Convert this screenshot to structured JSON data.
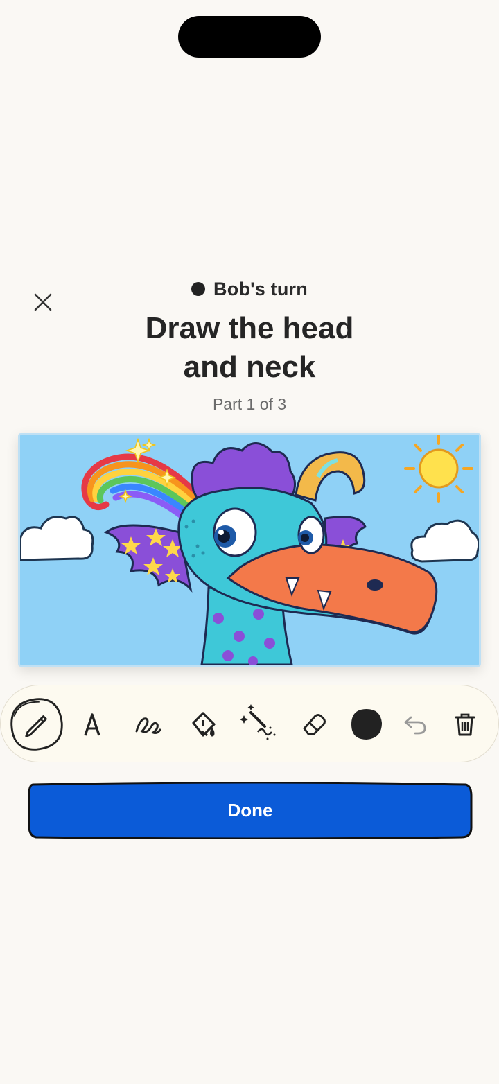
{
  "header": {
    "turn_label": "Bob's turn",
    "title_line1": "Draw the head",
    "title_line2": "and neck",
    "part_label": "Part 1 of 3"
  },
  "icons": {
    "close": "close-icon",
    "turn_indicator": "dot-icon"
  },
  "toolbar": {
    "tools": [
      {
        "name": "pencil",
        "icon": "pencil-icon",
        "selected": true
      },
      {
        "name": "pen",
        "icon": "pen-nib-icon"
      },
      {
        "name": "brush",
        "icon": "squiggle-icon"
      },
      {
        "name": "fill",
        "icon": "paint-bucket-icon"
      },
      {
        "name": "magic",
        "icon": "magic-wand-icon"
      },
      {
        "name": "eraser",
        "icon": "eraser-icon"
      },
      {
        "name": "color",
        "icon": "color-swatch-icon"
      },
      {
        "name": "undo",
        "icon": "undo-icon"
      },
      {
        "name": "clear",
        "icon": "trash-icon"
      }
    ],
    "current_color": "#222222"
  },
  "actions": {
    "done_label": "Done"
  },
  "colors": {
    "background": "#faf8f4",
    "accent": "#0b5bd8",
    "sky": "#8fd1f6"
  }
}
